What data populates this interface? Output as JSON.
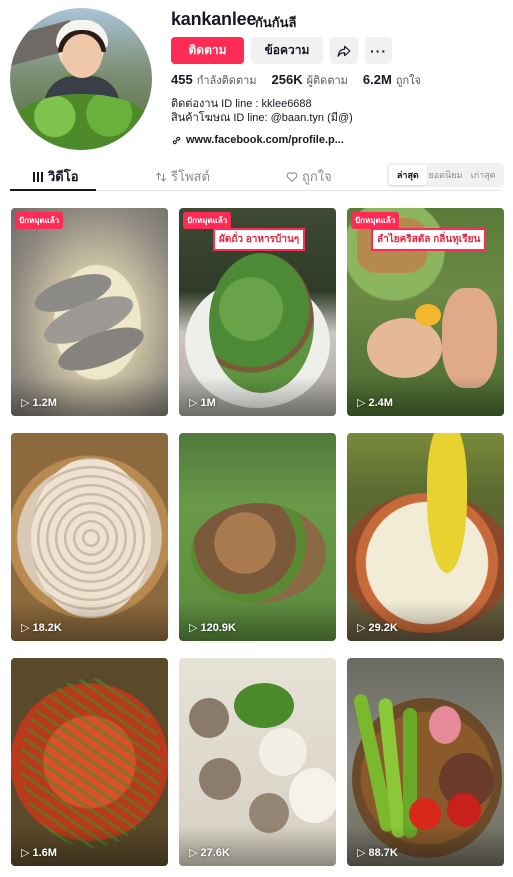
{
  "profile": {
    "username": "kankanlee",
    "nickname": "กันกันลี",
    "follow_label": "ติดตาม",
    "message_label": "ข้อความ",
    "more_label": "···",
    "stats": {
      "following_count": "455",
      "following_label": "กำลังติดตาม",
      "followers_count": "256K",
      "followers_label": "ผู้ติดตาม",
      "likes_count": "6.2M",
      "likes_label": "ถูกใจ"
    },
    "bio_line1": "ติดต่องาน ID line : kklee6688",
    "bio_line2": "สินค้าโฆษณ ID line: @baan.tyn (มี@)",
    "link": "www.facebook.com/profile.p..."
  },
  "tabs": {
    "videos": "วิดีโอ",
    "reposts": "รีโพสต์",
    "liked": "ถูกใจ"
  },
  "sort": {
    "latest": "ล่าสุด",
    "popular": "ยอดนิยม",
    "oldest": "เก่าสุด"
  },
  "videos": [
    {
      "views": "1.2M",
      "pinned": "ปักหมุดแล้ว",
      "overlay": ""
    },
    {
      "views": "1M",
      "pinned": "ปักหมุดแล้ว",
      "overlay": "ผัดถั่ว อาหารบ้านๆ"
    },
    {
      "views": "2.4M",
      "pinned": "ปักหมุดแล้ว",
      "overlay": "ลำไยคริสตัล กลิ่นทุเรียน"
    },
    {
      "views": "18.2K",
      "pinned": "",
      "overlay": ""
    },
    {
      "views": "120.9K",
      "pinned": "",
      "overlay": ""
    },
    {
      "views": "29.2K",
      "pinned": "",
      "overlay": ""
    },
    {
      "views": "1.6M",
      "pinned": "",
      "overlay": ""
    },
    {
      "views": "27.6K",
      "pinned": "",
      "overlay": ""
    },
    {
      "views": "88.7K",
      "pinned": "",
      "overlay": ""
    }
  ],
  "colors": {
    "accent": "#fe2c55",
    "text": "#161823",
    "muted": "#8a8b91"
  }
}
